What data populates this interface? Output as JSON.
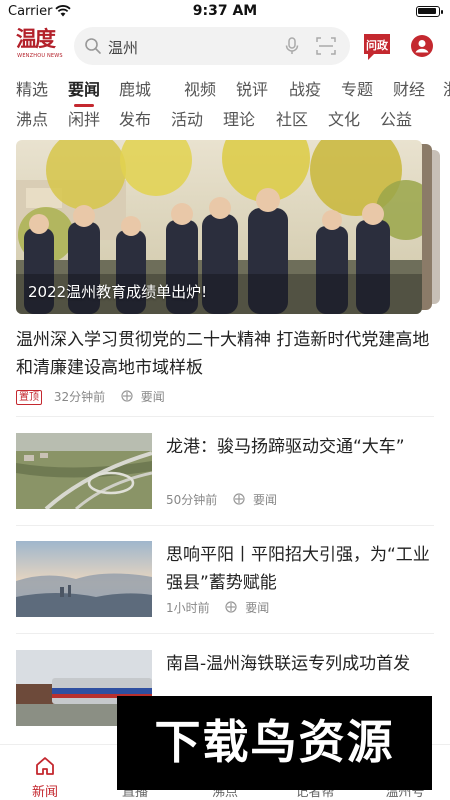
{
  "status_bar": {
    "carrier": "Carrier",
    "time": "9:37 AM"
  },
  "header": {
    "logo_text": "温度",
    "logo_sub": "WENZHOU NEWS",
    "search_text": "温州",
    "wenzheng_label": "问政"
  },
  "tabs_row1": [
    {
      "label": "精选"
    },
    {
      "label": "要闻",
      "active": true
    },
    {
      "label": "鹿城"
    },
    {
      "label": "视频"
    },
    {
      "label": "锐评"
    },
    {
      "label": "战疫"
    },
    {
      "label": "专题"
    },
    {
      "label": "财经"
    },
    {
      "label": "浙"
    }
  ],
  "tabs_row2": [
    {
      "label": "沸点"
    },
    {
      "label": "闲拌"
    },
    {
      "label": "发布"
    },
    {
      "label": "活动"
    },
    {
      "label": "理论"
    },
    {
      "label": "社区"
    },
    {
      "label": "文化"
    },
    {
      "label": "公益"
    }
  ],
  "feature": {
    "caption": "2022温州教育成绩单出炉!"
  },
  "headline": {
    "title": "温州深入学习贯彻党的二十大精神 打造新时代党建高地和清廉建设高地市域样板",
    "badge": "置顶",
    "time": "32分钟前",
    "channel": "要闻"
  },
  "news": [
    {
      "title": "龙港：骏马扬蹄驱动交通“大车”",
      "time": "50分钟前",
      "channel": "要闻"
    },
    {
      "title": "思响平阳丨平阳招大引强，为“工业强县”蓄势赋能",
      "time": "1小时前",
      "channel": "要闻"
    },
    {
      "title": "南昌-温州海铁联运专列成功首发",
      "time": "",
      "channel": ""
    }
  ],
  "bottom_nav": [
    {
      "label": "新闻",
      "active": true
    },
    {
      "label": "直播"
    },
    {
      "label": "沸点"
    },
    {
      "label": "记者帮"
    },
    {
      "label": "温州号"
    }
  ],
  "watermark": {
    "text": "下载鸟资源"
  },
  "colors": {
    "accent": "#c4282f",
    "logo": "#b3202a"
  }
}
